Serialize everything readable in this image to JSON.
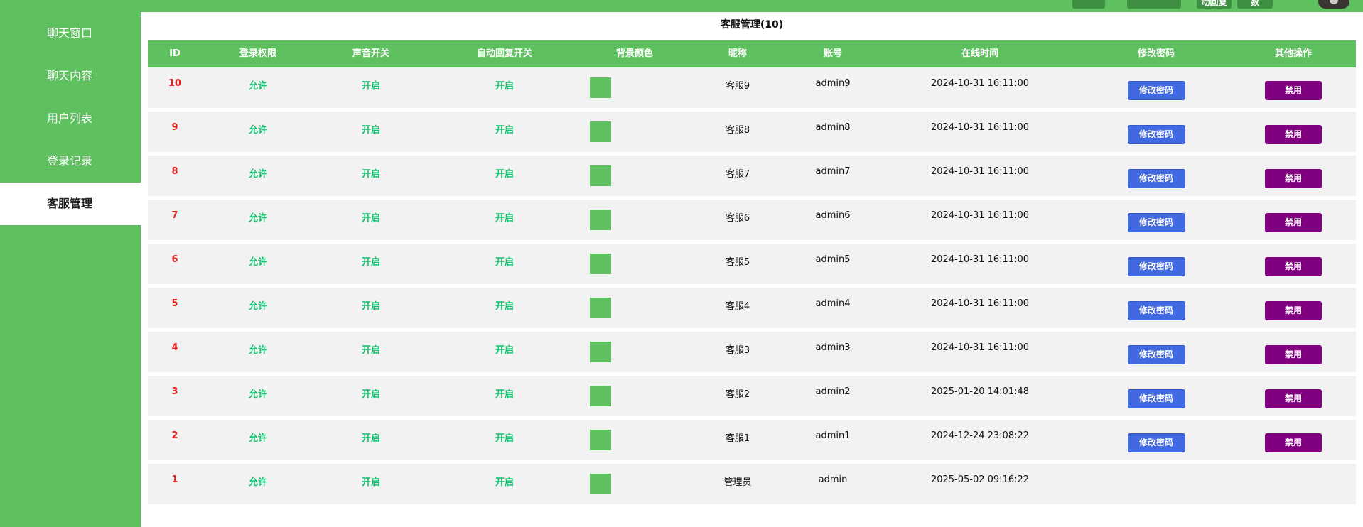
{
  "topbar": {
    "buttons": [
      "",
      "",
      "动回复",
      "数"
    ]
  },
  "sidebar": {
    "items": [
      {
        "label": "聊天窗口"
      },
      {
        "label": "聊天内容"
      },
      {
        "label": "用户列表"
      },
      {
        "label": "登录记录"
      },
      {
        "label": "客服管理"
      }
    ],
    "active_index": 4
  },
  "page": {
    "title": "客服管理(10)"
  },
  "table": {
    "headers": [
      "ID",
      "登录权限",
      "声音开关",
      "自动回复开关",
      "背景颜色",
      "昵称",
      "账号",
      "在线时间",
      "修改密码",
      "其他操作"
    ],
    "swatch_color": "#5fc060",
    "rows": [
      {
        "id": "10",
        "login": "允许",
        "sound": "开启",
        "auto_reply": "开启",
        "nickname": "客服9",
        "account": "admin9",
        "online": "2024-10-31 16:11:00",
        "pwd_label": "修改密码",
        "ban_label": "禁用"
      },
      {
        "id": "9",
        "login": "允许",
        "sound": "开启",
        "auto_reply": "开启",
        "nickname": "客服8",
        "account": "admin8",
        "online": "2024-10-31 16:11:00",
        "pwd_label": "修改密码",
        "ban_label": "禁用"
      },
      {
        "id": "8",
        "login": "允许",
        "sound": "开启",
        "auto_reply": "开启",
        "nickname": "客服7",
        "account": "admin7",
        "online": "2024-10-31 16:11:00",
        "pwd_label": "修改密码",
        "ban_label": "禁用"
      },
      {
        "id": "7",
        "login": "允许",
        "sound": "开启",
        "auto_reply": "开启",
        "nickname": "客服6",
        "account": "admin6",
        "online": "2024-10-31 16:11:00",
        "pwd_label": "修改密码",
        "ban_label": "禁用"
      },
      {
        "id": "6",
        "login": "允许",
        "sound": "开启",
        "auto_reply": "开启",
        "nickname": "客服5",
        "account": "admin5",
        "online": "2024-10-31 16:11:00",
        "pwd_label": "修改密码",
        "ban_label": "禁用"
      },
      {
        "id": "5",
        "login": "允许",
        "sound": "开启",
        "auto_reply": "开启",
        "nickname": "客服4",
        "account": "admin4",
        "online": "2024-10-31 16:11:00",
        "pwd_label": "修改密码",
        "ban_label": "禁用"
      },
      {
        "id": "4",
        "login": "允许",
        "sound": "开启",
        "auto_reply": "开启",
        "nickname": "客服3",
        "account": "admin3",
        "online": "2024-10-31 16:11:00",
        "pwd_label": "修改密码",
        "ban_label": "禁用"
      },
      {
        "id": "3",
        "login": "允许",
        "sound": "开启",
        "auto_reply": "开启",
        "nickname": "客服2",
        "account": "admin2",
        "online": "2025-01-20 14:01:48",
        "pwd_label": "修改密码",
        "ban_label": "禁用"
      },
      {
        "id": "2",
        "login": "允许",
        "sound": "开启",
        "auto_reply": "开启",
        "nickname": "客服1",
        "account": "admin1",
        "online": "2024-12-24 23:08:22",
        "pwd_label": "修改密码",
        "ban_label": "禁用"
      },
      {
        "id": "1",
        "login": "允许",
        "sound": "开启",
        "auto_reply": "开启",
        "nickname": "管理员",
        "account": "admin",
        "online": "2025-05-02 09:16:22",
        "pwd_label": "",
        "ban_label": ""
      }
    ]
  },
  "colors": {
    "brand_green": "#5fc060",
    "id_red": "#e61e1e",
    "status_green": "#12c26e",
    "pwd_button": "#4169e1",
    "ban_button": "#800080"
  }
}
